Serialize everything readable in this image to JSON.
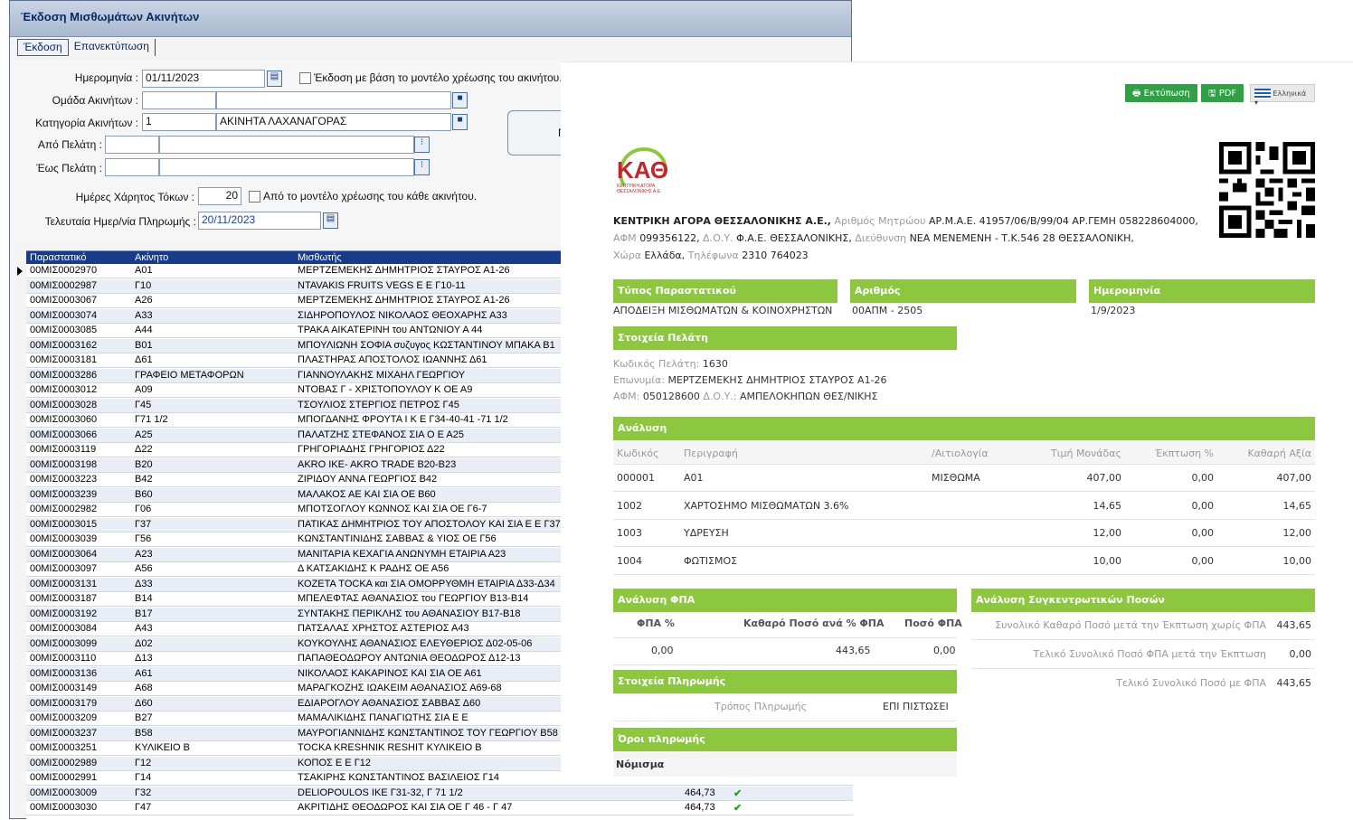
{
  "app": {
    "title": "Έκδοση Μισθωμάτων Ακινήτων",
    "tabs": [
      "Έκδοση",
      "Επανεκτύπωση"
    ],
    "form": {
      "date_label": "Ημερομηνία :",
      "date_value": "01/11/2023",
      "model_check_label": "Έκδοση με βάση το μοντέλο χρέωσης του ακινήτου.",
      "group_label": "Ομάδα Ακινήτων :",
      "category_label": "Κατηγορία Ακινήτων :",
      "category_code": "1",
      "category_name": "ΑΚΙΝΗΤΑ ΛΑΧΑΝΑΓΟΡΑΣ",
      "from_client_label": "Από Πελάτη :",
      "to_client_label": "Έως Πελάτη :",
      "grace_label": "Ημέρες Χάρητος Τόκων :",
      "grace_value": "20",
      "grace_check_label": "Από το μοντέλο χρέωσης του κάθε ακινήτου.",
      "last_pay_label": "Τελευταία Ημερ/νία Πληρωμής :",
      "last_pay_value": "20/11/2023",
      "side_button": "Π"
    },
    "grid": {
      "headers": [
        "Παραστατικό",
        "Ακίνητο",
        "Μισθωτής"
      ],
      "rows": [
        [
          "00ΜΙΣ0002970",
          "Α01",
          "ΜΕΡΤΖΕΜΕΚΗΣ ΔΗΜΗΤΡΙΟΣ ΣΤΑΥΡΟΣ Α1-26"
        ],
        [
          "00ΜΙΣ0002987",
          "Γ10",
          "NTAVAKIS FRUITS VEGS E E Γ10-11"
        ],
        [
          "00ΜΙΣ0003067",
          "Α26",
          "ΜΕΡΤΖΕΜΕΚΗΣ ΔΗΜΗΤΡΙΟΣ ΣΤΑΥΡΟΣ Α1-26"
        ],
        [
          "00ΜΙΣ0003074",
          "Α33",
          "ΣΙΔΗΡΟΠΟΥΛΟΣ ΝΙΚΟΛΑΟΣ ΘΕΟΧΑΡΗΣ Α33"
        ],
        [
          "00ΜΙΣ0003085",
          "Α44",
          "ΤΡΑΚΑ ΑΙΚΑΤΕΡΙΝΗ του ΑΝΤΩΝΙΟΥ Α 44"
        ],
        [
          "00ΜΙΣ0003162",
          "Β01",
          "ΜΠΟΥΛΙΩΝΗ ΣΟΦΙΑ συζυγος ΚΩΣΤΑΝΤΙΝΟΥ ΜΠΑΚΑ Β1"
        ],
        [
          "00ΜΙΣ0003181",
          "Δ61",
          "ΠΛΑΣΤΗΡΑΣ ΑΠΟΣΤΟΛΟΣ ΙΩΑΝΝΗΣ Δ61"
        ],
        [
          "00ΜΙΣ0003286",
          "ΓΡΑΦΕΙΟ ΜΕΤΑΦΟΡΩΝ",
          "ΓΙΑΝΝΟΥΛΑΚΗΣ ΜΙΧΑΗΛ ΓΕΩΡΓΙΟΥ"
        ],
        [
          "00ΜΙΣ0003012",
          "Α09",
          "ΝΤΟΒΑΣ Γ - ΧΡΙΣΤΟΠΟΥΛΟΥ Κ ΟΕ Α9"
        ],
        [
          "00ΜΙΣ0003028",
          "Γ45",
          "ΤΣΟΥΛΙΟΣ ΣΤΕΡΓΙΟΣ ΠΕΤΡΟΣ Γ45"
        ],
        [
          "00ΜΙΣ0003060",
          "Γ71 1/2",
          "ΜΠΟΓΔΑΝΗΣ ΦΡΟΥΤΑ Ι Κ Ε Γ34-40-41 -71 1/2"
        ],
        [
          "00ΜΙΣ0003066",
          "Α25",
          "ΠΑΛΑΤΖΗΣ ΣΤΕΦΑΝΟΣ ΣΙΑ Ο Ε Α25"
        ],
        [
          "00ΜΙΣ0003119",
          "Δ22",
          "ΓΡΗΓΟΡΙΑΔΗΣ ΓΡΗΓΟΡΙΟΣ Δ22"
        ],
        [
          "00ΜΙΣ0003198",
          "Β20",
          "AKRO IKE- AKRO TRADE B20-B23"
        ],
        [
          "00ΜΙΣ0003223",
          "Β42",
          "ΖΙΡΙΔΟΥ ΑΝΝΑ ΓΕΩΡΓΙΟΣ Β42"
        ],
        [
          "00ΜΙΣ0003239",
          "Β60",
          "ΜΑΛΑΚΟΣ ΑΕ ΚΑΙ ΣΙΑ ΟΕ Β60"
        ],
        [
          "00ΜΙΣ0002982",
          "Γ06",
          "ΜΠΟΤΣΟΓΛΟΥ ΚΩΝΝΟΣ ΚΑΙ ΣΙΑ ΟΕ Γ6-7"
        ],
        [
          "00ΜΙΣ0003015",
          "Γ37",
          "ΠΑΤΙΚΑΣ ΔΗΜΗΤΡΙΟΣ ΤΟΥ ΑΠΟΣΤΟΛΟΥ ΚΑΙ ΣΙΑ Ε Ε Γ37-3"
        ],
        [
          "00ΜΙΣ0003039",
          "Γ56",
          "ΚΩΝΣΤΑΝΤΙΝΙΔΗΣ ΣΑΒΒΑΣ & ΥΙΟΣ ΟΕ Γ56"
        ],
        [
          "00ΜΙΣ0003064",
          "Α23",
          "ΜΑΝΙΤΑΡΙΑ ΚΕΧΑΓΙΑ ΑΝΩΝΥΜΗ ΕΤΑΙΡΙΑ Α23"
        ],
        [
          "00ΜΙΣ0003097",
          "Α56",
          "Δ ΚΑΤΣΑΚΙΔΗΣ Κ ΡΑΔΗΣ ΟΕ Α56"
        ],
        [
          "00ΜΙΣ0003131",
          "Δ33",
          "ΚΟΖΕΤΑ TOCKA και ΣΙΑ ΟΜΟΡΡΥΘΜΗ ΕΤΑΙΡΙΑ Δ33-Δ34"
        ],
        [
          "00ΜΙΣ0003187",
          "Β14",
          "ΜΠΕΛΕΦΤΑΣ ΑΘΑΝΑΣΙΟΣ του ΓΕΩΡΓΙΟΥ Β13-Β14"
        ],
        [
          "00ΜΙΣ0003192",
          "Β17",
          "ΣΥΝΤΑΚΗΣ ΠΕΡΙΚΛΗΣ του ΑΘΑΝΑΣΙΟΥ Β17-Β18"
        ],
        [
          "00ΜΙΣ0003084",
          "Α43",
          "ΠΑΤΣΑΛΑΣ ΧΡΗΣΤΟΣ ΑΣΤΕΡΙΟΣ Α43"
        ],
        [
          "00ΜΙΣ0003099",
          "Δ02",
          "ΚΟΥΚΟΥΛΗΣ ΑΘΑΝΑΣΙΟΣ ΕΛΕΥΘΕΡΙΟΣ Δ02-05-06"
        ],
        [
          "00ΜΙΣ0003110",
          "Δ13",
          "ΠΑΠΑΘΕΟΔΩΡΟΥ ΑΝΤΩΝΙΑ ΘΕΟΔΩΡΟΣ Δ12-13"
        ],
        [
          "00ΜΙΣ0003136",
          "Α61",
          "ΝΙΚΟΛΑΟΣ ΚΑΚΑΡΙΝΟΣ ΚΑΙ ΣΙΑ ΟΕ Α61"
        ],
        [
          "00ΜΙΣ0003149",
          "Α68",
          "ΜΑΡΑΓΚΟΖΗΣ ΙΩΑΚΕΙΜ ΑΘΑΝΑΣΙΟΣ Α69-68"
        ],
        [
          "00ΜΙΣ0003179",
          "Δ60",
          "ΕΔΙΑΡΟΓΛΟΥ ΑΘΑΝΑΣΙΟΣ ΣΑΒΒΑΣ Δ60"
        ],
        [
          "00ΜΙΣ0003209",
          "Β27",
          "ΜΑΜΑΛΙΚΙΔΗΣ ΠΑΝΑΓΙΩΤΗΣ ΣΙΑ Ε Ε"
        ],
        [
          "00ΜΙΣ0003237",
          "Β58",
          "ΜΑΥΡΟΓΙΑΝΝΙΔΗΣ ΚΩΝΣΤΑΝΤΙΝΟΣ ΤΟΥ ΓΕΩΡΓΙΟΥ Β58"
        ],
        [
          "00ΜΙΣ0003251",
          "ΚΥΛΙΚΕΙΟ Β",
          "TOCKA KRESHNIK RESHIT ΚΥΛΙΚΕΙΟ Β"
        ],
        [
          "00ΜΙΣ0002989",
          "Γ12",
          "ΚΟΠΟΣ Ε Ε Γ12"
        ],
        [
          "00ΜΙΣ0002991",
          "Γ14",
          "ΤΣΑΚΙΡΗΣ ΚΩΝΣΤΑΝΤΙΝΟΣ ΒΑΣΙΛΕΙΟΣ Γ14"
        ],
        [
          "00ΜΙΣ0003009",
          "Γ32",
          "DELIOPOULOS ΙΚΕ Γ31-32, Γ 71 1/2",
          "464,73"
        ],
        [
          "00ΜΙΣ0003030",
          "Γ47",
          "ΑΚΡΙΤΙΔΗΣ ΘΕΟΔΩΡΟΣ ΚΑΙ ΣΙΑ ΟΕ Γ 46 - Γ 47",
          "464,73"
        ]
      ]
    }
  },
  "doc": {
    "print_btn": "Εκτύπωση",
    "pdf_btn": "PDF",
    "lang": "Ελληνικά",
    "logo_text": "ΚΑΘ",
    "logo_sub1": "ΚΕΝΤΡΙΚΗ ΑΓΟΡΑ",
    "logo_sub2": "ΘΕΣΣΑΛΟΝΙΚΗΣ Α.Ε.",
    "company": {
      "name": "ΚΕΝΤΡΙΚΗ ΑΓΟΡΑ ΘΕΣΣΑΛΟΝΙΚΗΣ Α.Ε.,",
      "reg_label": "Αριθμός Μητρώου",
      "reg": "ΑΡ.Μ.Α.Ε. 41957/06/Β/99/04 ΑΡ.ΓΕΜΗ 058228604000,",
      "afm_label": "ΑΦΜ",
      "afm": "099356122,",
      "doy_label": "Δ.Ο.Υ.",
      "doy": "Φ.Α.Ε. ΘΕΣΣΑΛΟΝΙΚΗΣ,",
      "addr_label": "Διεύθυνση",
      "addr": "ΝΕΑ ΜΕΝΕΜΕΝΗ - Τ.Κ.546 28 ΘΕΣΣΑΛΟΝΙΚΗ,",
      "country_label": "Χώρα",
      "country": "Ελλάδα,",
      "phone_label": "Τηλέφωνα",
      "phone": "2310 764023"
    },
    "type_hdr": "Τύπος Παραστατικού",
    "type_val": "ΑΠΟΔΕΙΞΗ ΜΙΣΘΩΜΑΤΩΝ & ΚΟΙΝΟΧΡΗΣΤΩΝ",
    "num_hdr": "Αριθμός",
    "num_val": "00ΑΠΜ - 2505",
    "date_hdr": "Ημερομηνία",
    "date_val": "1/9/2023",
    "client_hdr": "Στοιχεία Πελάτη",
    "client": {
      "code_label": "Κωδικός Πελάτη:",
      "code": "1630",
      "name_label": "Επωνυμία:",
      "name": "ΜΕΡΤΖΕΜΕΚΗΣ ΔΗΜΗΤΡΙΟΣ ΣΤΑΥΡΟΣ Α1-26",
      "afm_label": "ΑΦΜ:",
      "afm": "050128600",
      "doy_label": "Δ.Ο.Υ.:",
      "doy": "ΑΜΠΕΛΟΚΗΠΩΝ ΘΕΣ/ΝΙΚΗΣ"
    },
    "analysis_hdr": "Ανάλυση",
    "analysis_cols": [
      "Κωδικός",
      "Περιγραφή",
      "/Αιτιολογία",
      "Τιμή Μονάδας",
      "Έκπτωση %",
      "Καθαρή Αξία"
    ],
    "analysis_rows": [
      [
        "000001",
        "Α01",
        "ΜΙΣΘΩΜΑ",
        "407,00",
        "0,00",
        "407,00"
      ],
      [
        "1002",
        "ΧΑΡΤΟΣΗΜΟ ΜΙΣΘΩΜΑΤΩΝ 3.6%",
        "",
        "14,65",
        "0,00",
        "14,65"
      ],
      [
        "1003",
        "ΥΔΡΕΥΣΗ",
        "",
        "12,00",
        "0,00",
        "12,00"
      ],
      [
        "1004",
        "ΦΩΤΙΣΜΟΣ",
        "",
        "10,00",
        "0,00",
        "10,00"
      ]
    ],
    "vat_hdr": "Ανάλυση ΦΠΑ",
    "vat_cols": [
      "ΦΠΑ %",
      "Καθαρό Ποσό ανά % ΦΠΑ",
      "Ποσό ΦΠΑ"
    ],
    "vat_row": [
      "0,00",
      "443,65",
      "0,00"
    ],
    "sum_hdr": "Ανάλυση Συγκεντρωτικών Ποσών",
    "sums": [
      [
        "Συνολικό Καθαρό Ποσό μετά την Έκπτωση χωρίς ΦΠΑ",
        "443,65"
      ],
      [
        "Τελικό Συνολικό Ποσό ΦΠΑ μετά την Έκπτωση",
        "0,00"
      ],
      [
        "Τελικό Συνολικό Ποσό με ΦΠΑ",
        "443,65"
      ]
    ],
    "pay_hdr": "Στοιχεία Πληρωμής",
    "pay_label": "Τρόπος Πληρωμής",
    "pay_val": "ΕΠΙ ΠΙΣΤΩΣΕΙ",
    "terms_hdr": "Όροι πληρωμής",
    "currency_label": "Νόμισμα"
  },
  "colors": {
    "grid_header": "#173c8a",
    "green": "#8dc63f",
    "button_green": "#2fa043"
  }
}
